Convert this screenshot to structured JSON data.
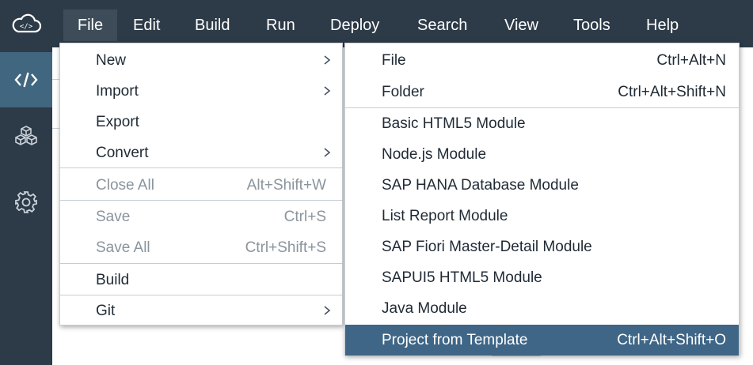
{
  "menubar": {
    "logo_icon": "cloud-code-icon",
    "items": [
      {
        "label": "File"
      },
      {
        "label": "Edit"
      },
      {
        "label": "Build"
      },
      {
        "label": "Run"
      },
      {
        "label": "Deploy"
      },
      {
        "label": "Search"
      },
      {
        "label": "View"
      },
      {
        "label": "Tools"
      },
      {
        "label": "Help"
      }
    ]
  },
  "rail": {
    "items": [
      {
        "icon": "code-icon",
        "active": true
      },
      {
        "icon": "cubes-icon",
        "active": false
      },
      {
        "icon": "gear-icon",
        "active": false
      }
    ]
  },
  "file_menu": {
    "items": [
      {
        "label": "New",
        "submenu": true
      },
      {
        "label": "Import",
        "submenu": true
      },
      {
        "label": "Export"
      },
      {
        "label": "Convert",
        "submenu": true
      },
      {
        "label": "Close All",
        "shortcut": "Alt+Shift+W",
        "disabled": true
      },
      {
        "label": "Save",
        "shortcut": "Ctrl+S",
        "disabled": true
      },
      {
        "label": "Save All",
        "shortcut": "Ctrl+Shift+S",
        "disabled": true
      },
      {
        "label": "Build"
      },
      {
        "label": "Git",
        "submenu": true
      }
    ]
  },
  "new_submenu": {
    "items": [
      {
        "label": "File",
        "shortcut": "Ctrl+Alt+N"
      },
      {
        "label": "Folder",
        "shortcut": "Ctrl+Alt+Shift+N"
      },
      {
        "label": "Basic HTML5 Module"
      },
      {
        "label": "Node.js Module"
      },
      {
        "label": "SAP HANA Database Module"
      },
      {
        "label": "List Report Module"
      },
      {
        "label": "SAP Fiori Master-Detail Module"
      },
      {
        "label": "SAPUI5 HTML5 Module"
      },
      {
        "label": "Java Module"
      },
      {
        "label": "Project from Template",
        "shortcut": "Ctrl+Alt+Shift+O",
        "selected": true
      }
    ]
  },
  "colors": {
    "menubar_bg": "#2d3a47",
    "rail_active": "#41667f",
    "selected_item": "#3f6687",
    "disabled_text": "#8a949d"
  }
}
